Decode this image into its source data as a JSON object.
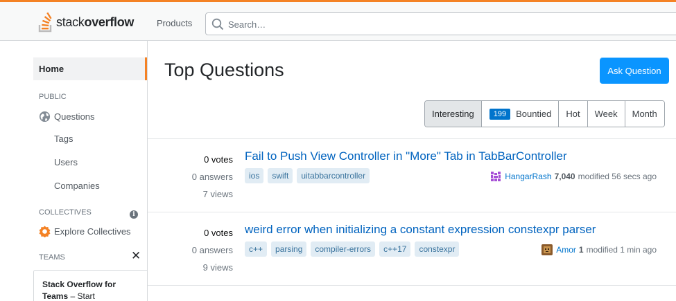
{
  "header": {
    "logo_light": "stack",
    "logo_bold": "overflow",
    "products_label": "Products",
    "search_placeholder": "Search…",
    "accent_color": "#f48225"
  },
  "sidebar": {
    "home_label": "Home",
    "public_label": "PUBLIC",
    "questions_label": "Questions",
    "tags_label": "Tags",
    "users_label": "Users",
    "companies_label": "Companies",
    "collectives_label": "COLLECTIVES",
    "explore_collectives_label": "Explore Collectives",
    "teams_label": "TEAMS",
    "teams_promo_title": "Stack Overflow for Teams",
    "teams_promo_rest": " – Start"
  },
  "main": {
    "title": "Top Questions",
    "ask_button_label": "Ask Question",
    "filters": {
      "interesting": "Interesting",
      "bounty_count": "199",
      "bountied": "Bountied",
      "hot": "Hot",
      "week": "Week",
      "month": "Month"
    },
    "questions": [
      {
        "votes": "0 votes",
        "answers": "0 answers",
        "views": "7 views",
        "title": "Fail to Push View Controller in \"More\" Tab in TabBarController",
        "tags": [
          "ios",
          "swift",
          "uitabbarcontroller"
        ],
        "user": "HangarRash",
        "rep": "7,040",
        "modified": "modified 56 secs ago"
      },
      {
        "votes": "0 votes",
        "answers": "0 answers",
        "views": "9 views",
        "title": "weird error when initializing a constant expression constexpr parser",
        "tags": [
          "c++",
          "parsing",
          "compiler-errors",
          "c++17",
          "constexpr"
        ],
        "user": "Amor",
        "rep": "1",
        "modified": "modified 1 min ago"
      }
    ]
  }
}
